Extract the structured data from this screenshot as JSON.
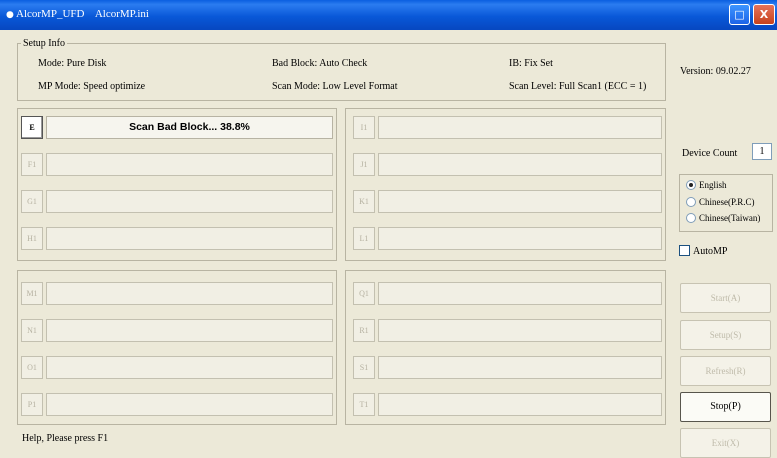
{
  "window": {
    "title": "AlcorMP_UFD    AlcorMP.ini",
    "title_icon": "app-icon",
    "maximize_icon": "maximize-icon",
    "close_icon": "close-icon",
    "maximize_glyph": "□",
    "close_glyph": "X",
    "title_color": "#0a5fe0",
    "close_color": "#c7421c"
  },
  "setup": {
    "legend": "Setup Info",
    "mode": "Mode: Pure Disk",
    "bad_block": "Bad Block: Auto Check",
    "ib": "IB: Fix Set",
    "mp_mode": "MP Mode: Speed optimize",
    "scan_mode": "Scan Mode: Low Level Format",
    "scan_level": "Scan Level: Full Scan1 (ECC = 1)"
  },
  "version": "Version: 09.02.27",
  "device_count": {
    "label": "Device Count",
    "value": "1"
  },
  "language": {
    "options": [
      {
        "label": "English",
        "selected": true
      },
      {
        "label": "Chinese(P.R.C)",
        "selected": false
      },
      {
        "label": "Chinese(Taiwan)",
        "selected": false
      }
    ]
  },
  "auto_mp": {
    "label": "AutoMP",
    "checked": false
  },
  "channels": [
    {
      "id": "A",
      "label": "E",
      "status": "Scan Bad Block... 38.8%",
      "active": true
    },
    {
      "id": "B",
      "label": "F1",
      "status": "",
      "active": false
    },
    {
      "id": "C",
      "label": "G1",
      "status": "",
      "active": false
    },
    {
      "id": "D",
      "label": "H1",
      "status": "",
      "active": false
    },
    {
      "id": "E",
      "label": "I1",
      "status": "",
      "active": false
    },
    {
      "id": "F",
      "label": "J1",
      "status": "",
      "active": false
    },
    {
      "id": "G",
      "label": "K1",
      "status": "",
      "active": false
    },
    {
      "id": "H",
      "label": "L1",
      "status": "",
      "active": false
    },
    {
      "id": "I",
      "label": "M1",
      "status": "",
      "active": false
    },
    {
      "id": "J",
      "label": "N1",
      "status": "",
      "active": false
    },
    {
      "id": "K",
      "label": "O1",
      "status": "",
      "active": false
    },
    {
      "id": "L",
      "label": "P1",
      "status": "",
      "active": false
    },
    {
      "id": "M",
      "label": "Q1",
      "status": "",
      "active": false
    },
    {
      "id": "N",
      "label": "R1",
      "status": "",
      "active": false
    },
    {
      "id": "O",
      "label": "S1",
      "status": "",
      "active": false
    },
    {
      "id": "P",
      "label": "T1",
      "status": "",
      "active": false
    }
  ],
  "actions": [
    {
      "label": "Start(A)",
      "enabled": false
    },
    {
      "label": "Setup(S)",
      "enabled": false
    },
    {
      "label": "Refresh(R)",
      "enabled": false
    },
    {
      "label": "Stop(P)",
      "enabled": true
    },
    {
      "label": "Exit(X)",
      "enabled": false
    }
  ],
  "status_bar": "Help, Please press F1"
}
